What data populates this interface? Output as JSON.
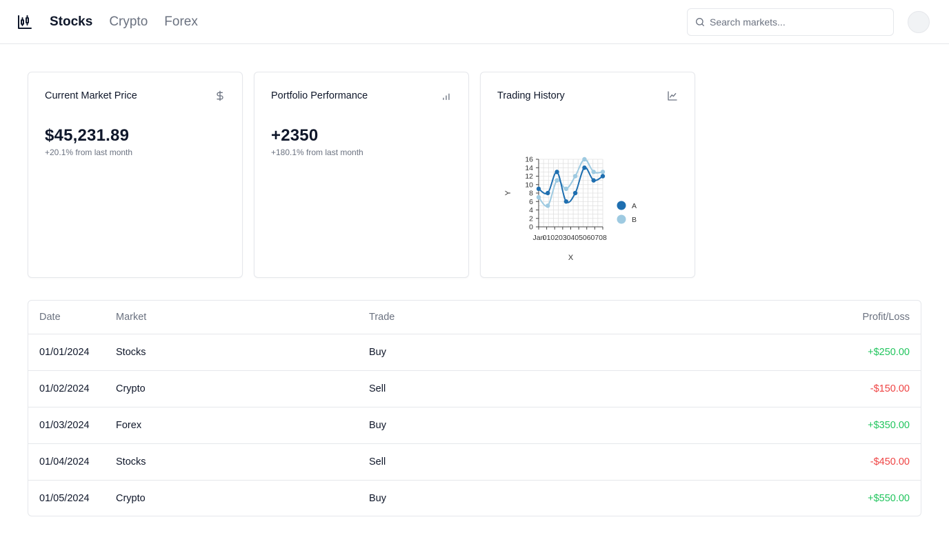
{
  "nav": {
    "items": [
      {
        "label": "Stocks",
        "active": true
      },
      {
        "label": "Crypto",
        "active": false
      },
      {
        "label": "Forex",
        "active": false
      }
    ]
  },
  "search": {
    "placeholder": "Search markets..."
  },
  "cards": [
    {
      "title": "Current Market Price",
      "value": "$45,231.89",
      "subtitle": "+20.1% from last month",
      "icon": "dollar-icon"
    },
    {
      "title": "Portfolio Performance",
      "value": "+2350",
      "subtitle": "+180.1% from last month",
      "icon": "bar-chart-icon"
    },
    {
      "title": "Trading History",
      "icon": "line-chart-icon"
    }
  ],
  "chart_data": {
    "type": "line",
    "categories": [
      "Jan",
      "01",
      "02",
      "03",
      "04",
      "05",
      "06",
      "07",
      "08"
    ],
    "series": [
      {
        "name": "A",
        "values": [
          9,
          8,
          13,
          6,
          8,
          14,
          11,
          12
        ],
        "color": "#1f6fb0"
      },
      {
        "name": "B",
        "values": [
          7,
          5,
          11,
          9,
          12,
          16,
          13,
          13
        ],
        "color": "#9ecae1"
      }
    ],
    "xlabel": "X",
    "ylabel": "Y",
    "ylim": [
      0,
      16
    ],
    "yticks": [
      0,
      2,
      4,
      6,
      8,
      10,
      12,
      14,
      16
    ],
    "grid": true,
    "legend": "right"
  },
  "table": {
    "headers": [
      "Date",
      "Market",
      "Trade",
      "Profit/Loss"
    ],
    "rows": [
      {
        "date": "01/01/2024",
        "market": "Stocks",
        "trade": "Buy",
        "pl": "+$250.00",
        "positive": true
      },
      {
        "date": "01/02/2024",
        "market": "Crypto",
        "trade": "Sell",
        "pl": "-$150.00",
        "positive": false
      },
      {
        "date": "01/03/2024",
        "market": "Forex",
        "trade": "Buy",
        "pl": "+$350.00",
        "positive": true
      },
      {
        "date": "01/04/2024",
        "market": "Stocks",
        "trade": "Sell",
        "pl": "-$450.00",
        "positive": false
      },
      {
        "date": "01/05/2024",
        "market": "Crypto",
        "trade": "Buy",
        "pl": "+$550.00",
        "positive": true
      }
    ]
  },
  "colors": {
    "positive": "#22c55e",
    "negative": "#ef4444",
    "muted": "#6b7280",
    "border": "#e5e7eb"
  }
}
